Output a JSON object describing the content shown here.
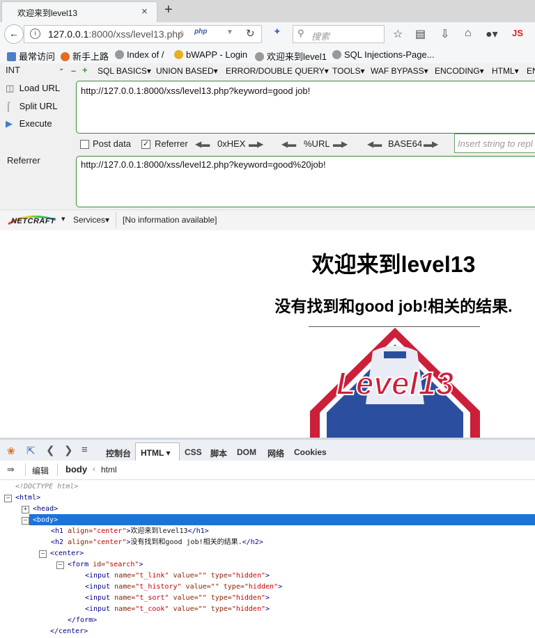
{
  "browser": {
    "tab_title": "欢迎来到level13",
    "tab_close": "×",
    "new_tab": "+",
    "url_host": "127.0.0.1",
    "url_rest": ":8000/xss/level13.php",
    "php_badge": "php",
    "search_placeholder": "搜索",
    "js_badge": "JS"
  },
  "bookmarks": [
    "最常访问",
    "新手上路",
    "Index of /",
    "bWAPP - Login",
    "欢迎来到level1",
    "SQL Injections-Page..."
  ],
  "hackbar": {
    "select_value": "INT",
    "menus": [
      "SQL BASICS▾",
      "UNION BASED▾",
      "ERROR/DOUBLE QUERY▾",
      "TOOLS▾",
      "WAF BYPASS▾",
      "ENCODING▾",
      "HTML▾",
      "EN"
    ],
    "load_url": "Load URL",
    "split_url": "Split URL",
    "execute": "Execute",
    "url_value": "http://127.0.0.1:8000/xss/level13.php?keyword=good job!",
    "post_data": "Post data",
    "referrer_cb": "Referrer",
    "hex": "0xHEX",
    "pct_url": "%URL",
    "base64": "BASE64",
    "insert_placeholder": "Insert string to repl",
    "referrer_label": "Referrer",
    "referrer_value": "http://127.0.0.1:8000/xss/level12.php?keyword=good%20job!"
  },
  "netcraft": {
    "logo": "NETCRAFT",
    "services": "Services▾",
    "info": "[No information available]"
  },
  "page": {
    "h1": "欢迎来到level13",
    "h2": "没有找到和good job!相关的结果.",
    "logo_text": "Level13"
  },
  "devtools": {
    "tabs": [
      "控制台",
      "HTML ▾",
      "CSS",
      "脚本",
      "DOM",
      "网络",
      "Cookies"
    ],
    "edit": "编辑",
    "crumb_body": "body",
    "crumb_html": "html",
    "doctype": "<!DOCTYPE html>",
    "h1_text": "欢迎来到level13",
    "h2_text": "没有找到和good job!相关的结果.",
    "inputs": [
      {
        "name": "t_link",
        "value": "",
        "type": "hidden"
      },
      {
        "name": "t_history",
        "value": "",
        "type": "hidden"
      },
      {
        "name": "t_sort",
        "value": "",
        "type": "hidden"
      },
      {
        "name": "t_cook",
        "value": "",
        "type": "hidden"
      }
    ]
  },
  "colors": {
    "selection": "#1a73d8",
    "hackbar_border": "#3a8a3a",
    "logo_red": "#cc1f3a",
    "logo_blue": "#2b4f9e"
  }
}
